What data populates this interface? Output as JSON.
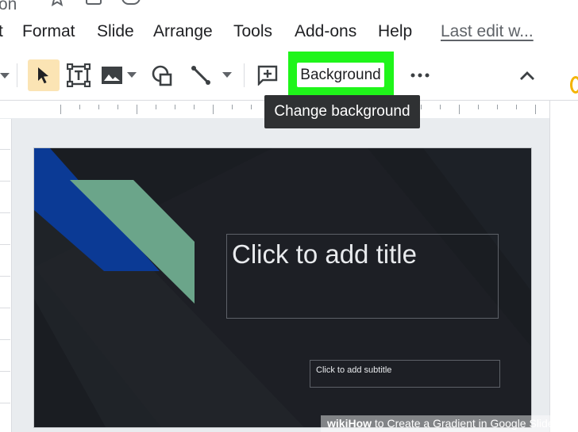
{
  "menubar": {
    "items": [
      "t",
      "Format",
      "Slide",
      "Arrange",
      "Tools",
      "Add-ons",
      "Help"
    ],
    "partial_title": "on",
    "last_edit": "Last edit w..."
  },
  "toolbar": {
    "background_label": "Background",
    "icons": [
      "dropdown-arrow-icon",
      "select-cursor-icon",
      "text-box-icon",
      "image-icon",
      "shape-icon",
      "line-icon",
      "comment-icon",
      "more-icon",
      "collapse-icon"
    ]
  },
  "tooltip": {
    "text": "Change background"
  },
  "slide": {
    "title_placeholder": "Click to add title",
    "subtitle_placeholder": "Click to add subtitle",
    "colors": {
      "background": "#1a1d22",
      "blue_stripe": "#0b3a95",
      "green_stripe": "#6ba58a",
      "placeholder_border": "#5d6168"
    }
  },
  "highlight_color": "#1ff51a",
  "watermark": {
    "brand": "wiki",
    "how": "How",
    "rest": " to Create a Gradient in Google Slides"
  }
}
